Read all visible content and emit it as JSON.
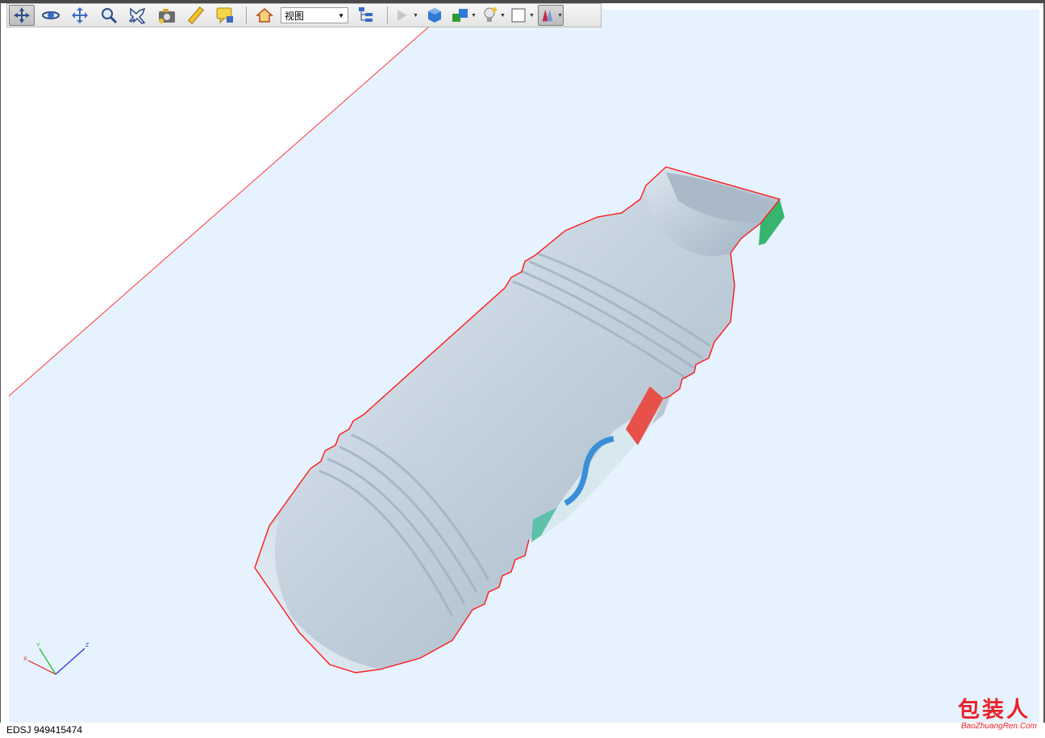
{
  "toolbar": {
    "tools": [
      {
        "name": "navigate-tool",
        "icon": "navigate-icon",
        "active": true
      },
      {
        "name": "orbit-tool",
        "icon": "orbit-icon"
      },
      {
        "name": "pan-tool",
        "icon": "pan-icon"
      },
      {
        "name": "zoom-tool",
        "icon": "zoom-icon"
      },
      {
        "name": "fly-tool",
        "icon": "airplane-icon"
      },
      {
        "name": "snapshot-tool",
        "icon": "camera-icon"
      },
      {
        "name": "measure-tool",
        "icon": "ruler-icon"
      },
      {
        "name": "comment-tool",
        "icon": "comment-icon"
      }
    ],
    "home_icon": "home-icon",
    "view_select": {
      "value": "视图"
    },
    "tree_icon": "model-tree-icon",
    "play_icon": "play-icon",
    "render_icon": "cube-icon",
    "section_icon": "section-cube-icon",
    "lighting_icon": "lighting-icon",
    "background_icon": "background-color-icon",
    "render_mode_icon": "render-mode-icon"
  },
  "viewport": {
    "background_color": "#e6f2fe",
    "selection_color": "#ff0000",
    "axis_labels": {
      "x": "X",
      "y": "Y",
      "z": "Z"
    }
  },
  "status": {
    "text": "EDSJ 949415474"
  },
  "watermark": {
    "chinese": "包装人",
    "english": "BaoZhuangRen.Com",
    "color": "#e8212a"
  }
}
